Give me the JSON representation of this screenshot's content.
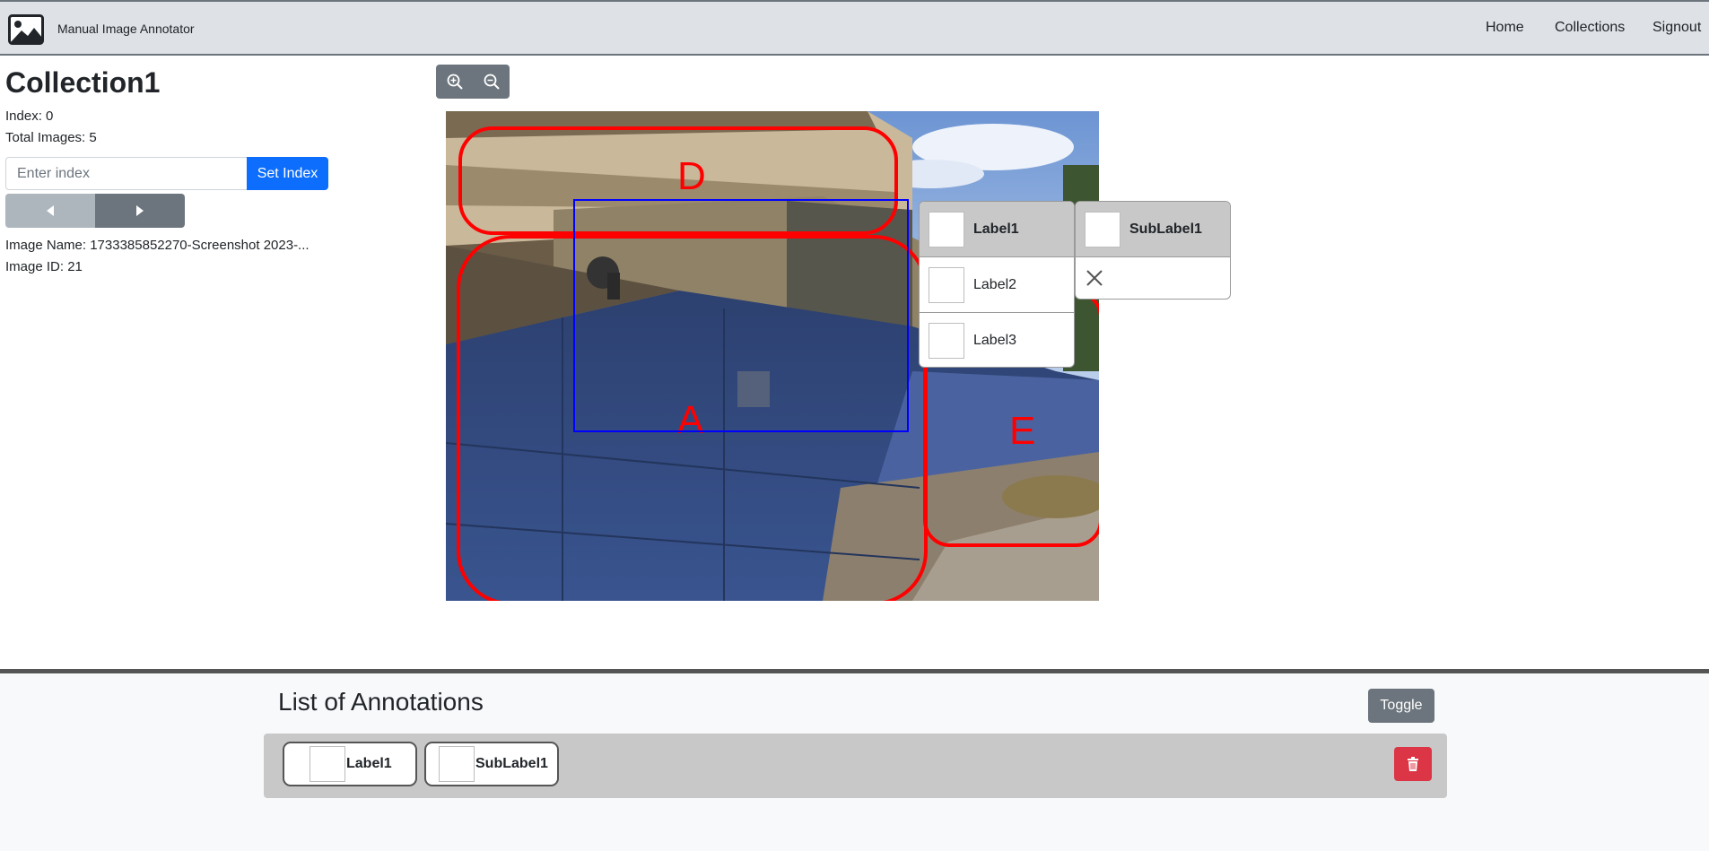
{
  "navbar": {
    "brand": "Manual Image Annotator",
    "links": {
      "home": "Home",
      "collections": "Collections",
      "signout": "Signout"
    }
  },
  "collection": {
    "title": "Collection1",
    "index_text": "Index: 0",
    "total_text": "Total Images: 5",
    "index_placeholder": "Enter index",
    "set_index_label": "Set Index",
    "image_name_text": "Image Name: 1733385852270-Screenshot 2023-...",
    "image_id_text": "Image ID: 21"
  },
  "annotations_on_image": [
    {
      "letter": "D",
      "color": "#ff0000"
    },
    {
      "letter": "A",
      "color": "#ff0000"
    },
    {
      "letter": "E",
      "color": "#ff0000"
    }
  ],
  "selection_box_color": "#0000ff",
  "label_menu": {
    "items": [
      "Label1",
      "Label2",
      "Label3"
    ],
    "active": "Label1"
  },
  "sublabel_menu": {
    "items": [
      "SubLabel1"
    ],
    "active": "SubLabel1",
    "close_icon": "close-icon"
  },
  "annotation_list": {
    "title": "List of Annotations",
    "toggle_label": "Toggle",
    "rows": [
      {
        "chips": [
          "Label1",
          "SubLabel1"
        ],
        "delete_icon": "trash-icon"
      }
    ]
  },
  "colors": {
    "primary": "#0d6efd",
    "secondary": "#6c757d",
    "danger": "#dc3545",
    "box": "#ff0000"
  }
}
